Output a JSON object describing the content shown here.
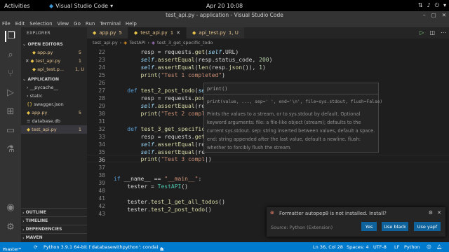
{
  "topbar": {
    "activities": "Activities",
    "app": "Visual Studio Code",
    "clock": "Apr 20  10:08"
  },
  "window": {
    "title": "test_api.py - application - Visual Studio Code"
  },
  "menu": [
    "File",
    "Edit",
    "Selection",
    "View",
    "Go",
    "Run",
    "Terminal",
    "Help"
  ],
  "sidebar": {
    "header": "EXPLORER",
    "open_editors": "OPEN EDITORS",
    "open_files": [
      {
        "name": "app.py",
        "badge": "5"
      },
      {
        "name": "test_api.py",
        "badge": "1"
      },
      {
        "name": "api_test.p...",
        "badge": "1, U"
      }
    ],
    "project": "APPLICATION",
    "files": [
      {
        "name": "__pycache__",
        "badge": ""
      },
      {
        "name": "static",
        "badge": ""
      },
      {
        "name": "swagger.json",
        "badge": ""
      },
      {
        "name": "app.py",
        "badge": "5"
      },
      {
        "name": "database.db",
        "badge": ""
      },
      {
        "name": "test_api.py",
        "badge": "1"
      }
    ],
    "bottom": [
      "OUTLINE",
      "TIMELINE",
      "DEPENDENCIES",
      "MAVEN"
    ]
  },
  "tabs": [
    {
      "name": "app.py",
      "badge": "5"
    },
    {
      "name": "test_api.py",
      "badge": "1"
    },
    {
      "name": "api_test.py",
      "badge": "1, U"
    }
  ],
  "breadcrumb": [
    "test_api.py",
    "TestAPI",
    "test_3_get_specific_todo"
  ],
  "editor": {
    "line_numbers": [
      "22",
      "23",
      "24",
      "25",
      "26",
      "27",
      "28",
      "29",
      "30",
      "31",
      "32",
      "33",
      "34",
      "35",
      "36",
      "37",
      "38",
      "39",
      "40",
      "41",
      "42",
      "43"
    ]
  },
  "hover": {
    "sig_short": "print()",
    "sig_full": "print(value, ..., sep=' ', end='\\n', file=sys.stdout, flush=False)",
    "doc": "Prints the values to a stream, or to sys.stdout by default. Optional keyword arguments: file: a file-like object (stream); defaults to the current sys.stdout. sep: string inserted between values, default a space. end: string appended after the last value, default a newline. flush: whether to forcibly flush the stream."
  },
  "notification": {
    "message": "Formatter autopep8 is not installed. Install?",
    "source": "Source: Python (Extension)",
    "buttons": [
      "Yes",
      "Use black",
      "Use yapf"
    ]
  },
  "status": {
    "branch": "master*",
    "python": "Python 3.9.1 64-bit ('databasewithpython': conda)",
    "errors": "0",
    "warnings": "0",
    "position": "Ln 36, Col 28",
    "spaces": "Spaces: 4",
    "encoding": "UTF-8",
    "eol": "LF",
    "language": "Python"
  },
  "colors": {
    "accent": "#007acc",
    "modified": "#e2c08d"
  }
}
